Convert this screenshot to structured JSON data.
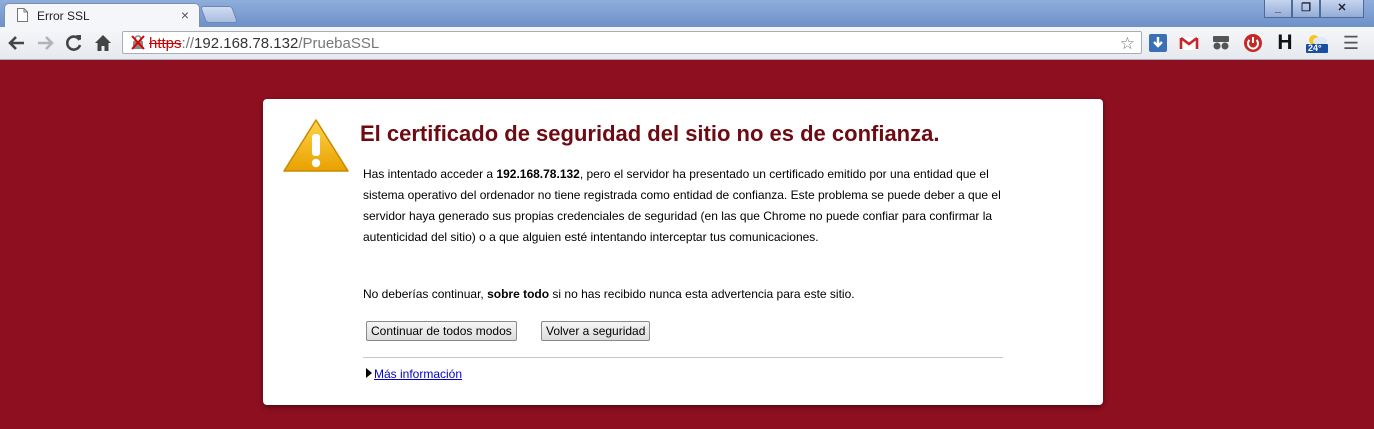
{
  "tab": {
    "title": "Error SSL",
    "close": "×"
  },
  "window_controls": {
    "minimize": "_",
    "maximize": "❐",
    "close": "✕"
  },
  "address_bar": {
    "scheme": "https",
    "host_sep": "://",
    "host": "192.168.78.132",
    "path": "/PruebaSSL"
  },
  "extensions": [
    "download-icon",
    "gmail-icon",
    "spy-icon",
    "power-icon",
    "h-icon",
    "weather-icon"
  ],
  "extension_labels": {
    "h": "H",
    "weather": "24°"
  },
  "menu_icon": "☰",
  "page": {
    "heading": "El certificado de seguridad del sitio no es de confianza.",
    "p1_pre": "Has intentado acceder a ",
    "p1_host": "192.168.78.132",
    "p1_post": ", pero el servidor ha presentado un certificado emitido por una entidad que el sistema operativo del ordenador no tiene registrada como entidad de confianza. Este problema se puede deber a que el servidor haya generado sus propias credenciales de seguridad (en las que Chrome no puede confiar para confirmar la autenticidad del sitio) o a que alguien esté intentando interceptar tus comunicaciones.",
    "p2_pre": "No deberías continuar, ",
    "p2_bold": "sobre todo",
    "p2_post": " si no has recibido nunca esta advertencia para este sitio.",
    "button_continue": "Continuar de todos modos",
    "button_back": "Volver a seguridad",
    "more_info": "Más información"
  },
  "colors": {
    "background": "#8e0f20",
    "heading": "#6d0a12",
    "link": "#0000cc",
    "warning_icon": "#f2b200"
  }
}
